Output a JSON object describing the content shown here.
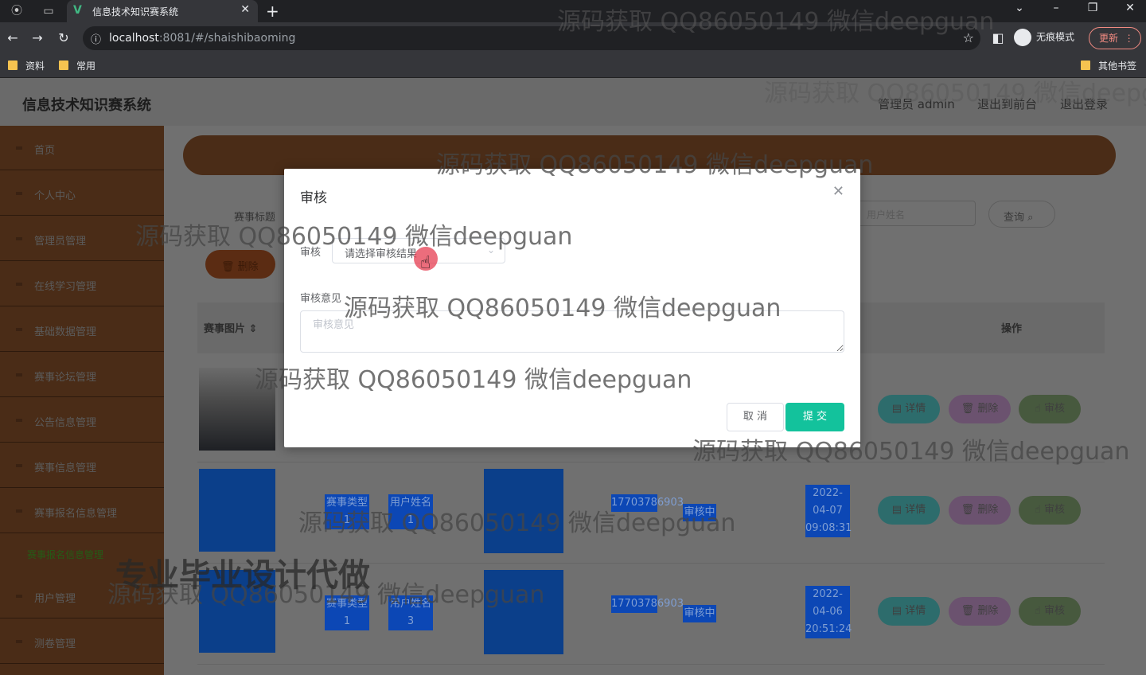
{
  "browser": {
    "tab_title": "信息技术知识赛系统",
    "url_host": "localhost",
    "url_rest": ":8081/#/shaishibaoming",
    "incognito_label": "无痕模式",
    "update_label": "更新",
    "bookmarks": [
      "资料",
      "常用"
    ],
    "other_bookmarks": "其他书签"
  },
  "app": {
    "title": "信息技术知识赛系统",
    "header_links": [
      "管理员 admin",
      "退出到前台",
      "退出登录"
    ]
  },
  "sidebar": {
    "items": [
      "首页",
      "个人中心",
      "管理员管理",
      "在线学习管理",
      "基础数据管理",
      "赛事论坛管理",
      "公告信息管理",
      "赛事信息管理",
      "赛事报名信息管理",
      "用户管理",
      "测卷管理"
    ],
    "active_sub": "赛事报名信息管理"
  },
  "main": {
    "search_label": "赛事标题",
    "search_placeholder": "用户姓名",
    "query_label": "查询",
    "delete_label": "删除",
    "table_headers": [
      "赛事图片",
      "操作"
    ],
    "rows": [
      {
        "type": "",
        "user": "",
        "phone": "",
        "status": "",
        "time": ""
      },
      {
        "type": "赛事类型1",
        "user": "用户姓名1",
        "phone": "17703786903",
        "status": "审核中",
        "time": "2022-04-07 09:08:31"
      },
      {
        "type": "赛事类型1",
        "user": "用户姓名3",
        "phone": "17703786903",
        "status": "审核中",
        "time": "2022-04-06 20:51:24"
      }
    ],
    "op_labels": {
      "detail": "详情",
      "delete": "删除",
      "audit": "审核"
    }
  },
  "modal": {
    "title": "审核",
    "audit_label": "审核",
    "audit_placeholder": "请选择审核结果",
    "opinion_label": "审核意见",
    "opinion_placeholder": "审核意见",
    "cancel_label": "取 消",
    "submit_label": "提 交"
  },
  "watermarks": {
    "text": "源码获取 QQ86050149 微信deepguan",
    "big": "专业毕业设计代做"
  },
  "colors": {
    "sidebar": "#4a2c17",
    "submit": "#13c29c",
    "selection": "#0c47b5"
  }
}
